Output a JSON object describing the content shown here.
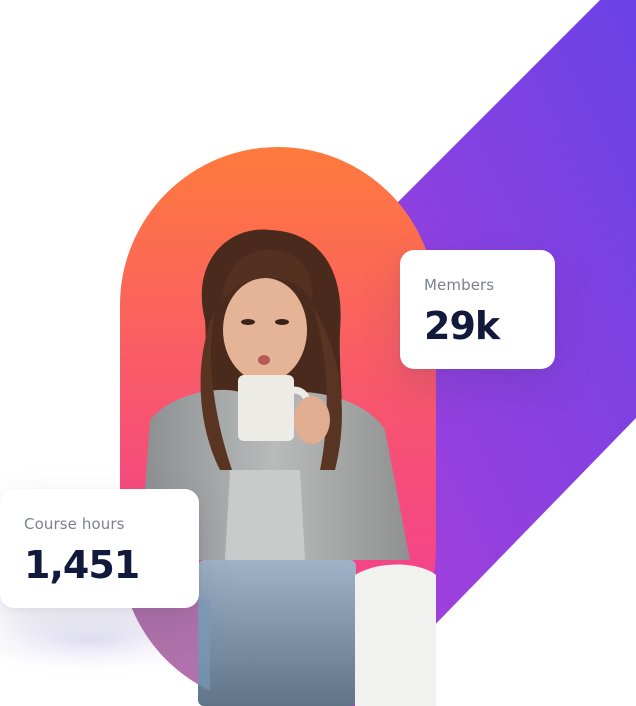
{
  "stats": {
    "members": {
      "label": "Members",
      "value": "29k"
    },
    "course_hours": {
      "label": "Course hours",
      "value": "1,451"
    }
  },
  "colors": {
    "ribbon_start": "#6a42e6",
    "ribbon_end": "#b13fd8",
    "pill_top": "#ff7a3d",
    "pill_bottom": "#f23a9a",
    "text_dark": "#111a3b",
    "text_muted": "#7b7f95"
  }
}
